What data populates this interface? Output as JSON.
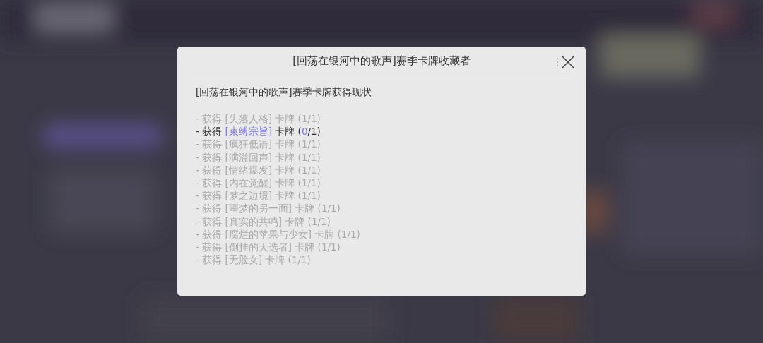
{
  "dialog": {
    "title": "[回荡在银河中的歌声]赛季卡牌收藏者",
    "heading": "[回荡在银河中的歌声]赛季卡牌获得现状",
    "items": [
      {
        "prefix": "- 获得",
        "card": "[失落人格]",
        "unit": "卡牌",
        "open": "(",
        "count": "1",
        "rest": "/1)",
        "completed": true
      },
      {
        "prefix": "- 获得",
        "card": "[束缚宗旨]",
        "unit": "卡牌",
        "open": "(",
        "count": "0",
        "rest": "/1)",
        "completed": false
      },
      {
        "prefix": "- 获得",
        "card": "[疯狂低语]",
        "unit": "卡牌",
        "open": "(",
        "count": "1",
        "rest": "/1)",
        "completed": true
      },
      {
        "prefix": "- 获得",
        "card": "[满溢回声]",
        "unit": "卡牌",
        "open": "(",
        "count": "1",
        "rest": "/1)",
        "completed": true
      },
      {
        "prefix": "- 获得",
        "card": "[情绪爆发]",
        "unit": "卡牌",
        "open": "(",
        "count": "1",
        "rest": "/1)",
        "completed": true
      },
      {
        "prefix": "- 获得",
        "card": "[内在觉醒]",
        "unit": "卡牌",
        "open": "(",
        "count": "1",
        "rest": "/1)",
        "completed": true
      },
      {
        "prefix": "- 获得",
        "card": "[梦之边境]",
        "unit": "卡牌",
        "open": "(",
        "count": "1",
        "rest": "/1)",
        "completed": true
      },
      {
        "prefix": "- 获得",
        "card": "[噩梦的另一面]",
        "unit": "卡牌",
        "open": "(",
        "count": "1",
        "rest": "/1)",
        "completed": true
      },
      {
        "prefix": "- 获得",
        "card": "[真实的共鸣]",
        "unit": "卡牌",
        "open": "(",
        "count": "1",
        "rest": "/1)",
        "completed": true
      },
      {
        "prefix": "- 获得",
        "card": "[腐烂的苹果与少女]",
        "unit": "卡牌",
        "open": "(",
        "count": "1",
        "rest": "/1)",
        "completed": true
      },
      {
        "prefix": "- 获得",
        "card": "[倒挂的天选者]",
        "unit": "卡牌",
        "open": "(",
        "count": "1",
        "rest": "/1)",
        "completed": true
      },
      {
        "prefix": "- 获得",
        "card": "[无脸女]",
        "unit": "卡牌",
        "open": "(",
        "count": "1",
        "rest": "/1)",
        "completed": true
      }
    ]
  }
}
